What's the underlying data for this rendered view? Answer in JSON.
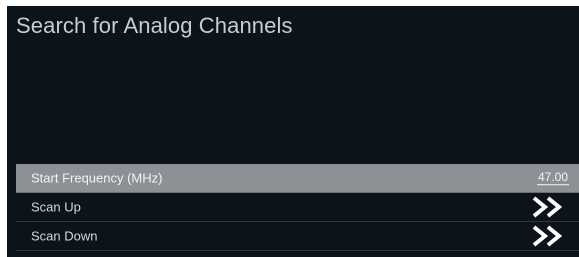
{
  "screen": {
    "title": "Search for Analog Channels"
  },
  "menu": {
    "items": [
      {
        "label": "Start Frequency (MHz)",
        "value": "47.00",
        "selected": true
      },
      {
        "label": "Scan Up",
        "icon": "double-chevron-right-icon"
      },
      {
        "label": "Scan Down",
        "icon": "double-chevron-right-icon"
      }
    ]
  },
  "colors": {
    "background": "#0d131b",
    "selected_row": "#8d9196",
    "text": "#d5d8dc"
  }
}
